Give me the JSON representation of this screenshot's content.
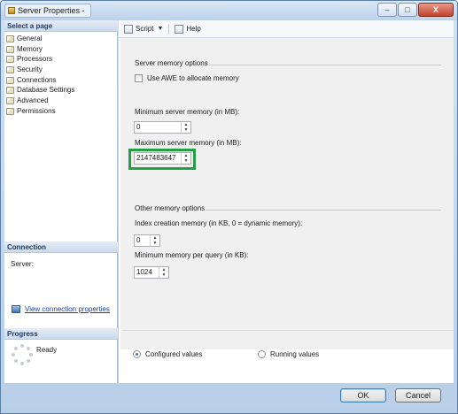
{
  "window": {
    "title": "Server Properties - ",
    "controls": [
      "–",
      "□",
      "X"
    ]
  },
  "sidebar": {
    "select_page_header": "Select a page",
    "items": [
      {
        "label": "General"
      },
      {
        "label": "Memory"
      },
      {
        "label": "Processors"
      },
      {
        "label": "Security"
      },
      {
        "label": "Connections"
      },
      {
        "label": "Database Settings"
      },
      {
        "label": "Advanced"
      },
      {
        "label": "Permissions"
      }
    ],
    "connection_header": "Connection",
    "server_label": "Server:",
    "view_connection_link": "View connection properties",
    "progress_header": "Progress",
    "progress_status": "Ready"
  },
  "toolbar": {
    "script_label": "Script",
    "help_label": "Help"
  },
  "memory": {
    "server_memory_header": "Server memory options",
    "awe_label": "Use AWE to allocate memory",
    "awe_checked": false,
    "min_label": "Minimum server memory (in MB):",
    "min_value": "0",
    "max_label": "Maximum server memory (in MB):",
    "max_value": "2147483647",
    "other_header": "Other memory options",
    "index_label": "Index creation memory (in KB, 0 = dynamic memory):",
    "index_value": "0",
    "min_query_label": "Minimum memory per query (in KB):",
    "min_query_value": "1024"
  },
  "view_mode": {
    "configured_label": "Configured values",
    "running_label": "Running values",
    "selected": "configured"
  },
  "buttons": {
    "ok": "OK",
    "cancel": "Cancel"
  },
  "colors": {
    "highlight": "#23a045"
  }
}
